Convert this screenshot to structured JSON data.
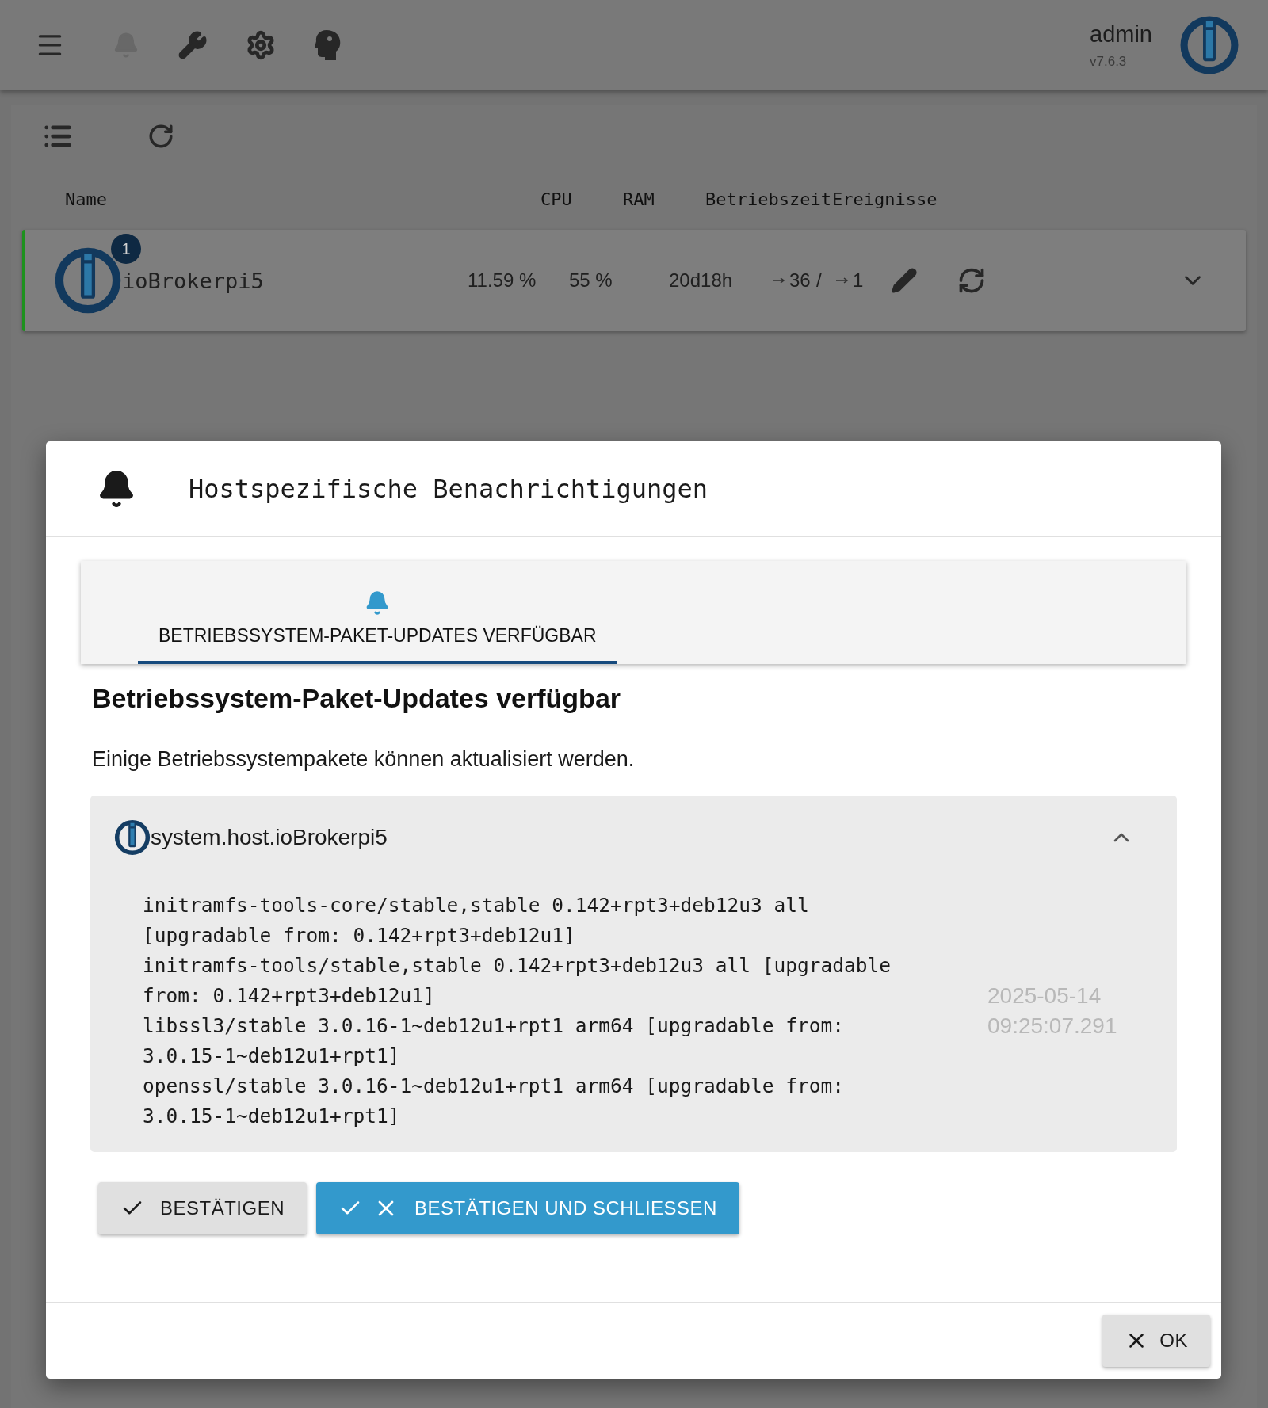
{
  "app_bar": {
    "user": "admin",
    "version": "v7.6.3",
    "notifications_disabled": true
  },
  "hosts_table": {
    "columns": [
      "Name",
      "CPU",
      "RAM",
      "Betriebszeit",
      "Ereignisse"
    ],
    "rows": [
      {
        "alive": true,
        "badge": "1",
        "name": "ioBrokerpi5",
        "cpu": "11.59 %",
        "ram": "55 %",
        "uptime": "20d18h",
        "events": {
          "incoming": "36",
          "separator": "/",
          "outgoing": "1"
        },
        "expanded": false
      }
    ]
  },
  "dialog": {
    "title": "Hostspezifische Benachrichtigungen",
    "tabs": [
      {
        "label": "BETRIEBSSYSTEM-PAKET-UPDATES VERFÜGBAR",
        "selected": true
      }
    ],
    "heading": "Betriebssystem-Paket-Updates verfügbar",
    "description": "Einige Betriebssystempakete können aktualisiert werden.",
    "accordion": {
      "title": "system.host.ioBrokerpi5",
      "expanded": true,
      "lines": [
        "initramfs-tools-core/stable,stable 0.142+rpt3+deb12u3 all",
        "[upgradable from: 0.142+rpt3+deb12u1]",
        "initramfs-tools/stable,stable 0.142+rpt3+deb12u3 all [upgradable",
        "from: 0.142+rpt3+deb12u1]",
        "libssl3/stable 3.0.16-1~deb12u1+rpt1 arm64 [upgradable from:",
        "3.0.15-1~deb12u1+rpt1]",
        "openssl/stable 3.0.16-1~deb12u1+rpt1 arm64 [upgradable from:",
        "3.0.15-1~deb12u1+rpt1]"
      ],
      "timestamp": [
        "2025-05-14",
        "09:25:07.291"
      ]
    },
    "actions": [
      {
        "kind": "confirm",
        "label": "BESTÄTIGEN"
      },
      {
        "kind": "confirm_close",
        "label": "BESTÄTIGEN UND SCHLIESSEN"
      }
    ],
    "ok_button": "OK"
  }
}
